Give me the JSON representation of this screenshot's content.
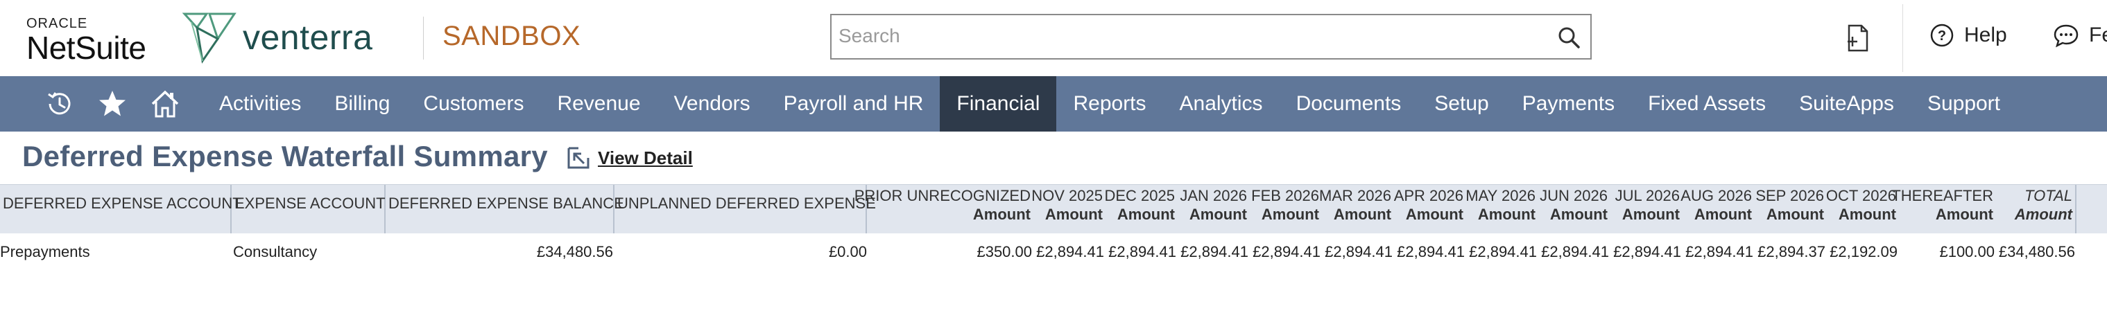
{
  "branding": {
    "oracle_top": "ORACLE",
    "oracle_main": "NetSuite",
    "company": "venterra",
    "environment": "SANDBOX",
    "environment_color": "#b6682a"
  },
  "search": {
    "placeholder": "Search"
  },
  "header_actions": {
    "help_label": "Help",
    "feedback_label": "Fe"
  },
  "nav": {
    "background": "#607799",
    "active_color": "#2e3a4a",
    "icons": [
      "recent-history-icon",
      "star-icon",
      "home-icon"
    ],
    "items": [
      {
        "label": "Activities"
      },
      {
        "label": "Billing"
      },
      {
        "label": "Customers"
      },
      {
        "label": "Revenue"
      },
      {
        "label": "Vendors"
      },
      {
        "label": "Payroll and HR"
      },
      {
        "label": "Financial",
        "active": true
      },
      {
        "label": "Reports"
      },
      {
        "label": "Analytics"
      },
      {
        "label": "Documents"
      },
      {
        "label": "Setup"
      },
      {
        "label": "Payments"
      },
      {
        "label": "Fixed Assets"
      },
      {
        "label": "SuiteApps"
      },
      {
        "label": "Support"
      }
    ]
  },
  "page": {
    "title": "Deferred Expense Waterfall Summary",
    "view_detail": "View Detail"
  },
  "table": {
    "columns": [
      {
        "label": "DEFERRED EXPENSE ACCOUNT"
      },
      {
        "label": "EXPENSE ACCOUNT"
      },
      {
        "label": "DEFERRED EXPENSE BALANCE"
      },
      {
        "label": "UNPLANNED DEFERRED EXPENSE"
      },
      {
        "label": "PRIOR UNRECOGNIZED",
        "sub": "Amount"
      },
      {
        "label": "NOV 2025",
        "sub": "Amount"
      },
      {
        "label": "DEC 2025",
        "sub": "Amount"
      },
      {
        "label": "JAN 2026",
        "sub": "Amount"
      },
      {
        "label": "FEB 2026",
        "sub": "Amount"
      },
      {
        "label": "MAR 2026",
        "sub": "Amount"
      },
      {
        "label": "APR 2026",
        "sub": "Amount"
      },
      {
        "label": "MAY 2026",
        "sub": "Amount"
      },
      {
        "label": "JUN 2026",
        "sub": "Amount"
      },
      {
        "label": "JUL 2026",
        "sub": "Amount"
      },
      {
        "label": "AUG 2026",
        "sub": "Amount"
      },
      {
        "label": "SEP 2026",
        "sub": "Amount"
      },
      {
        "label": "OCT 2026",
        "sub": "Amount"
      },
      {
        "label": "THEREAFTER",
        "sub": "Amount"
      },
      {
        "label": "TOTAL",
        "sub": "Amount"
      }
    ],
    "rows": [
      [
        "Prepayments",
        "Consultancy",
        "£34,480.56",
        "£0.00",
        "£350.00",
        "£2,894.41",
        "£2,894.41",
        "£2,894.41",
        "£2,894.41",
        "£2,894.41",
        "£2,894.41",
        "£2,894.41",
        "£2,894.41",
        "£2,894.41",
        "£2,894.41",
        "£2,894.37",
        "£2,192.09",
        "£100.00",
        "£34,480.56"
      ]
    ]
  }
}
